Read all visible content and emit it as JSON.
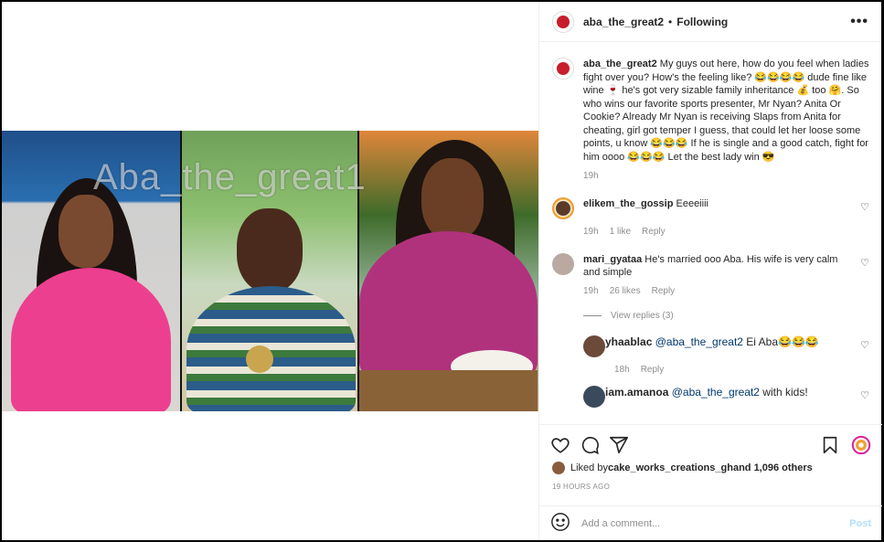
{
  "header": {
    "username": "aba_the_great2",
    "separator": "•",
    "follow_status": "Following",
    "more_label": "•••"
  },
  "media": {
    "watermark": "Aba_the_great1"
  },
  "caption": {
    "username": "aba_the_great2",
    "text": " My guys out here, how do you feel when ladies fight over you? How's the feeling like? 😂😂😂😂 dude fine like wine 🍷 he's got very sizable family inheritance 💰 too 🤗. So who wins our favorite sports presenter, Mr Nyan? Anita Or Cookie? Already Mr Nyan is receiving Slaps from Anita for cheating, girl got temper I guess, that could let her loose some points, u know 😂😂😂 If he is single and a good catch, fight for him oooo 😂😂😂 Let the best lady win 😎",
    "time": "19h"
  },
  "comments": [
    {
      "username": "elikem_the_gossip",
      "text": " Eeeeiiii",
      "time": "19h",
      "likes": "1 like",
      "reply_label": "Reply"
    },
    {
      "username": "mari_gyataa",
      "text": " He's married ooo Aba. His wife is very calm and simple",
      "time": "19h",
      "likes": "26 likes",
      "reply_label": "Reply",
      "view_replies": "View replies (3)"
    }
  ],
  "replies": [
    {
      "username": "yhaablac",
      "mention": " @aba_the_great2",
      "text": " Ei Aba😂😂😂",
      "time": "18h",
      "reply_label": "Reply"
    },
    {
      "username": "iam.amanoa",
      "mention": " @aba_the_great2",
      "text": " with kids!",
      "time": "",
      "reply_label": ""
    }
  ],
  "likes_summary": {
    "prefix": "Liked by ",
    "user": "cake_works_creations_gh",
    "suffix": " and 1,096 others"
  },
  "timestamp": "19 HOURS AGO",
  "add_comment": {
    "placeholder": "Add a comment...",
    "post_label": "Post"
  },
  "icons": {
    "like": "heart-icon",
    "comment": "comment-icon",
    "share": "share-icon",
    "save": "bookmark-icon",
    "emoji": "emoji-icon",
    "more": "more-icon"
  },
  "colors": {
    "brand_red": "#c81d2a",
    "link": "#00376b",
    "muted": "#8e8e8e",
    "post_disabled": "#b2dffc"
  }
}
